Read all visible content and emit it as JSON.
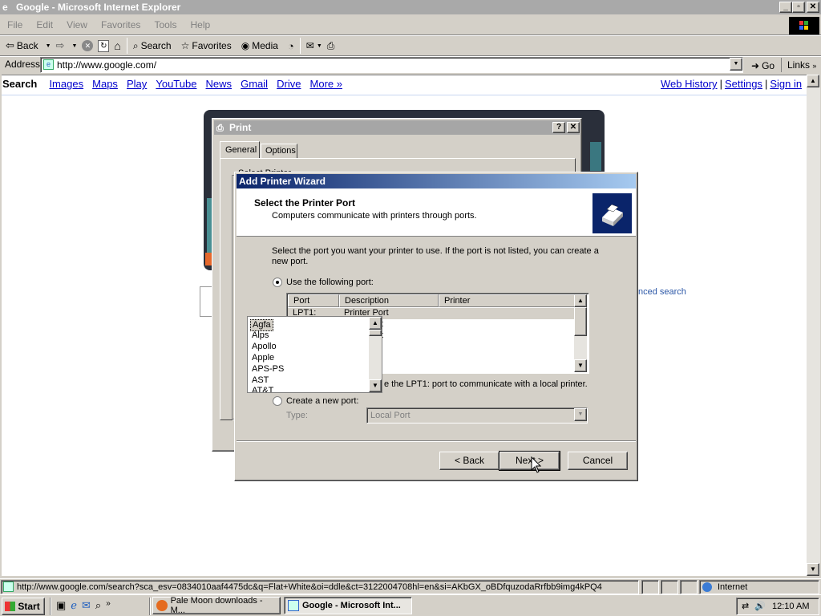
{
  "window": {
    "title": "Google - Microsoft Internet Explorer"
  },
  "menu": [
    "File",
    "Edit",
    "View",
    "Favorites",
    "Tools",
    "Help"
  ],
  "toolbar": {
    "back": "Back",
    "search": "Search",
    "favorites": "Favorites",
    "media": "Media"
  },
  "address": {
    "label": "Address",
    "url": "http://www.google.com/",
    "go": "Go",
    "links": "Links"
  },
  "google_bar": {
    "left": [
      "Search",
      "Images",
      "Maps",
      "Play",
      "YouTube",
      "News",
      "Gmail",
      "Drive",
      "More »"
    ],
    "right": [
      "Web History",
      "Settings",
      "Sign in"
    ],
    "separator": "|",
    "advanced_partial": "nced search"
  },
  "print_dialog": {
    "title": "Print",
    "tabs": [
      "General",
      "Options"
    ],
    "partial_label": "Select Printer"
  },
  "wizard": {
    "title": "Add Printer Wizard",
    "heading": "Select the Printer Port",
    "subheading": "Computers communicate with printers through ports.",
    "instruction": "Select the port you want your printer to use.  If the port is not listed, you can create a new port.",
    "use_port_label": "Use the following port:",
    "columns": [
      "Port",
      "Description",
      "Printer"
    ],
    "rows": [
      {
        "port": "LPT1:",
        "description": "Printer Port"
      },
      {
        "port": "",
        "description": "t"
      },
      {
        "port": "",
        "description": "t"
      }
    ],
    "note_partial": "e the LPT1: port to communicate with a local printer.",
    "create_port_label": "Create a new port:",
    "type_label": "Type:",
    "type_value": "Local Port",
    "back": "< Back",
    "next": "Next >",
    "cancel": "Cancel"
  },
  "manufacturer_list": [
    "Agfa",
    "Alps",
    "Apollo",
    "Apple",
    "APS-PS",
    "AST",
    "AT&T"
  ],
  "status": {
    "url": "http://www.google.com/search?sca_esv=0834010aaf4475dc&q=Flat+White&oi=ddle&ct=3122004708hl=en&si=AKbGX_oBDfquzodaRrfbb9img4kPQ4",
    "zone": "Internet"
  },
  "taskbar": {
    "start": "Start",
    "tasks": [
      "Pale Moon downloads - M...",
      "Google - Microsoft Int..."
    ],
    "time": "12:10 AM"
  }
}
